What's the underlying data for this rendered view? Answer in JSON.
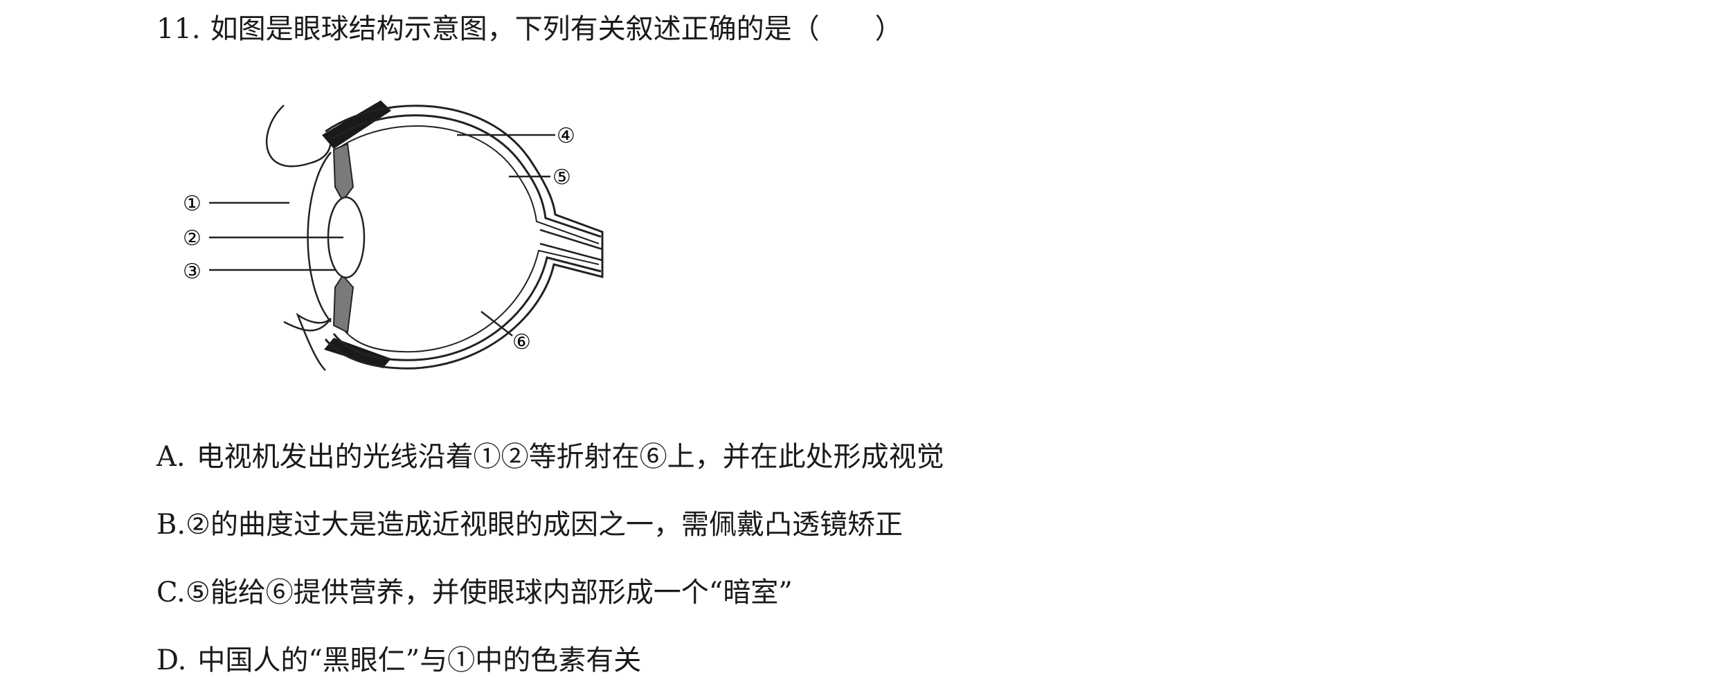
{
  "question": {
    "number": "11.",
    "stem": "如图是眼球结构示意图，下列有关叙述正确的是（　　）"
  },
  "figure": {
    "labels": [
      "①",
      "②",
      "③",
      "④",
      "⑤",
      "⑥"
    ]
  },
  "options": [
    {
      "letter": "A.",
      "text": "电视机发出的光线沿着①②等折射在⑥上，并在此处形成视觉"
    },
    {
      "letter": "B.",
      "text": "②的曲度过大是造成近视眼的成因之一，需佩戴凸透镜矫正"
    },
    {
      "letter": "C.",
      "text": "⑤能给⑥提供营养，并使眼球内部形成一个“暗室”"
    },
    {
      "letter": "D.",
      "text": "中国人的“黑眼仁”与①中的色素有关"
    }
  ]
}
